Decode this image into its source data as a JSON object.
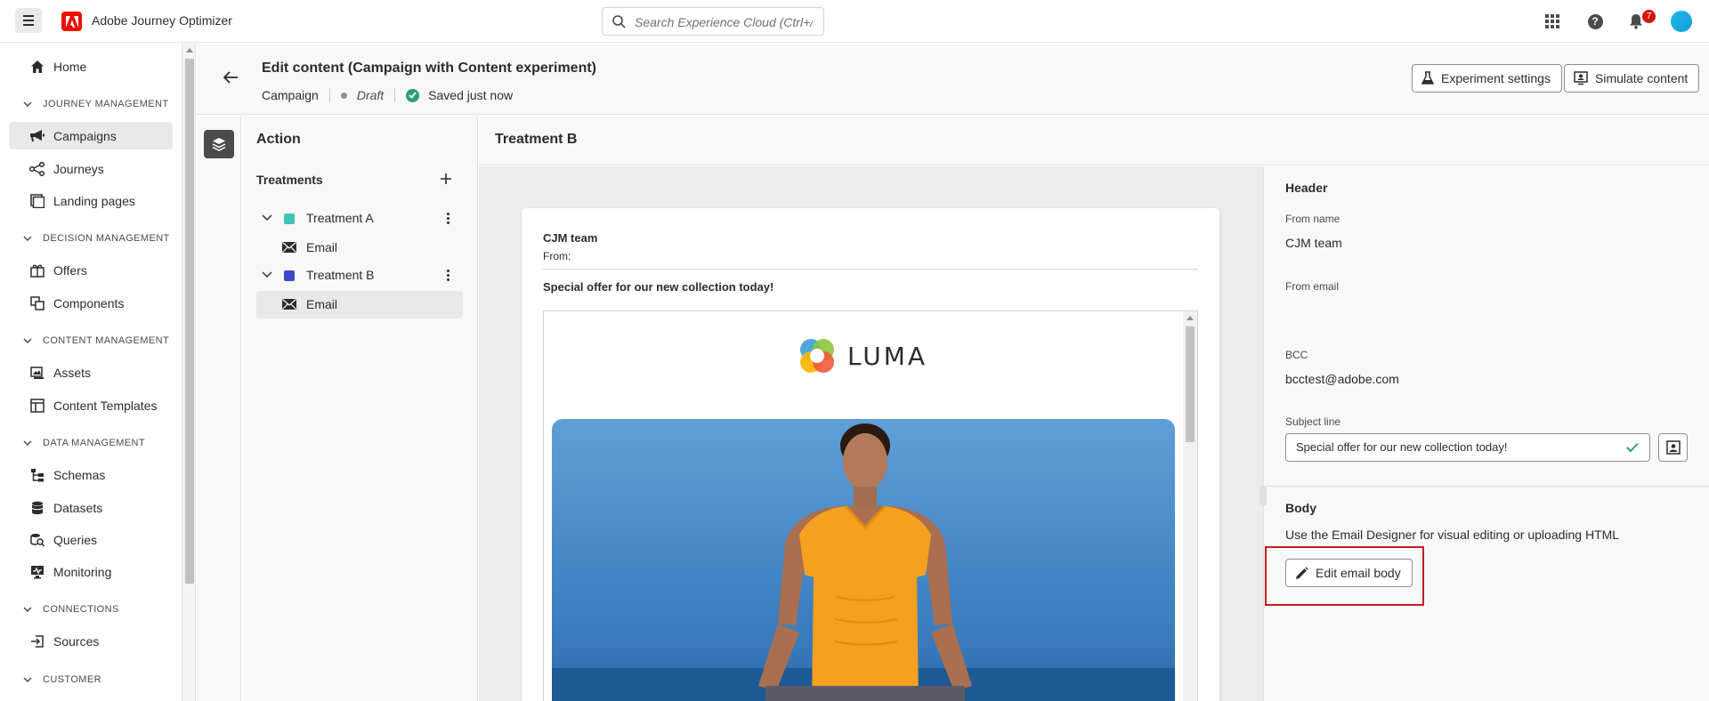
{
  "app": {
    "title": "Adobe Journey Optimizer",
    "search_placeholder": "Search Experience Cloud (Ctrl+/)",
    "notification_count": "7"
  },
  "sidebar": {
    "home": "Home",
    "sections": [
      {
        "label": "JOURNEY MANAGEMENT",
        "items": [
          "Campaigns",
          "Journeys",
          "Landing pages"
        ]
      },
      {
        "label": "DECISION MANAGEMENT",
        "items": [
          "Offers",
          "Components"
        ]
      },
      {
        "label": "CONTENT MANAGEMENT",
        "items": [
          "Assets",
          "Content Templates"
        ]
      },
      {
        "label": "DATA MANAGEMENT",
        "items": [
          "Schemas",
          "Datasets",
          "Queries",
          "Monitoring"
        ]
      },
      {
        "label": "CONNECTIONS",
        "items": [
          "Sources"
        ]
      },
      {
        "label": "CUSTOMER",
        "items": []
      }
    ],
    "active_item": "Campaigns"
  },
  "header": {
    "title": "Edit content (Campaign with Content experiment)",
    "type": "Campaign",
    "status": "Draft",
    "save_status": "Saved just now",
    "experiment_settings": "Experiment settings",
    "simulate_content": "Simulate content"
  },
  "action_panel": {
    "title": "Action",
    "treatments_label": "Treatments",
    "treatments": [
      {
        "name": "Treatment A",
        "color": "#3fc6b6",
        "channel": "Email"
      },
      {
        "name": "Treatment B",
        "color": "#4046ca",
        "channel": "Email"
      }
    ]
  },
  "center": {
    "title": "Treatment B",
    "from_name": "CJM team",
    "from_label": "From:",
    "subject": "Special offer for our new collection today!",
    "brand": "LUMA"
  },
  "properties": {
    "header_title": "Header",
    "from_name_label": "From name",
    "from_name_value": "CJM team",
    "from_email_label": "From email",
    "bcc_label": "BCC",
    "bcc_value": "bcctest@adobe.com",
    "subject_label": "Subject line",
    "subject_value": "Special offer for our new collection today!",
    "body_title": "Body",
    "body_desc": "Use the Email Designer for visual editing or uploading HTML",
    "edit_body": "Edit email body"
  }
}
